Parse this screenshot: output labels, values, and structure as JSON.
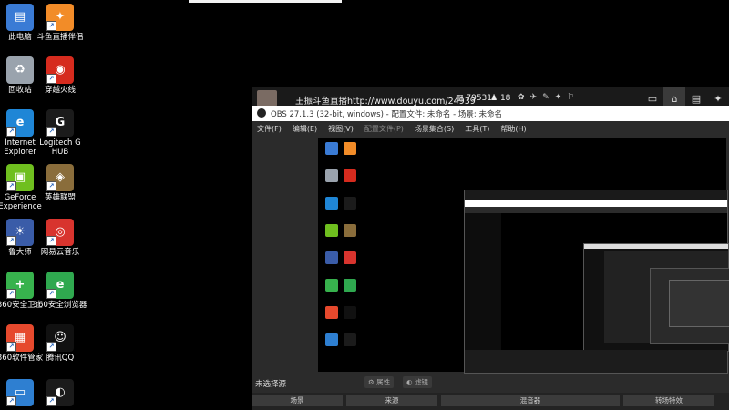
{
  "desktop": {
    "icons": [
      {
        "label": "此电脑",
        "icon": "computer-icon",
        "color": "#3a7bd5"
      },
      {
        "label": "斗鱼直播伴侣",
        "icon": "douyu-icon",
        "color": "#f28c28"
      },
      {
        "label": "回收站",
        "icon": "recycle-bin-icon",
        "color": "#9aa3ad"
      },
      {
        "label": "穿越火线",
        "icon": "crossfire-icon",
        "color": "#d62b1e"
      },
      {
        "label": "Internet Explorer",
        "icon": "ie-icon",
        "color": "#1f86d6"
      },
      {
        "label": "Logitech G HUB",
        "icon": "logitech-icon",
        "color": "#1b1b1b"
      },
      {
        "label": "GeForce Experience",
        "icon": "geforce-icon",
        "color": "#6fbf1f"
      },
      {
        "label": "英雄联盟",
        "icon": "lol-icon",
        "color": "#8a6d3b"
      },
      {
        "label": "鲁大师",
        "icon": "ludashi-icon",
        "color": "#3a5ca8"
      },
      {
        "label": "网易云音乐",
        "icon": "netease-music-icon",
        "color": "#d8342e"
      },
      {
        "label": "360安全卫士",
        "icon": "360-security-icon",
        "color": "#37b24d"
      },
      {
        "label": "360安全浏览器",
        "icon": "360-browser-icon",
        "color": "#2fa84f"
      },
      {
        "label": "360软件管家",
        "icon": "360-software-icon",
        "color": "#e6492d"
      },
      {
        "label": "腾讯QQ",
        "icon": "qq-icon",
        "color": "#111111"
      },
      {
        "label": "",
        "icon": "app-icon",
        "color": "#2e7fd1"
      },
      {
        "label": "",
        "icon": "obs-icon",
        "color": "#1b1b1b"
      }
    ]
  },
  "stream": {
    "title": "王振斗鱼直播http://www.douyu.com/24939",
    "views": "79531",
    "fans": "18",
    "home_icon": "home-icon",
    "layout_icon": "layout-icon",
    "gamepad_icon": "gamepad-icon"
  },
  "obs": {
    "title": "OBS 27.1.3 (32-bit, windows) - 配置文件: 未命名 - 场景: 未命名",
    "menu": [
      "文件(F)",
      "编辑(E)",
      "视图(V)",
      "配置文件(P)",
      "场景集合(S)",
      "工具(T)",
      "帮助(H)"
    ],
    "no_source": "未选择源",
    "properties": "属性",
    "filters": "滤镜",
    "docks": [
      "场景",
      "来源",
      "混音器",
      "转场特效"
    ],
    "scene_first": "场景"
  }
}
